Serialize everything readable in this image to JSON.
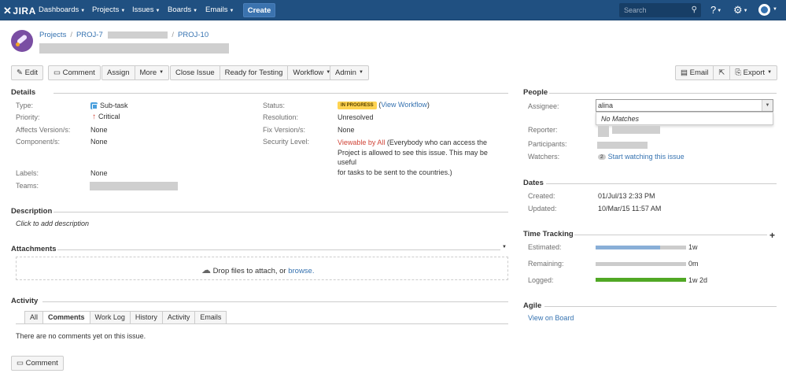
{
  "nav": {
    "logo": "JIRA",
    "items": [
      "Dashboards",
      "Projects",
      "Issues",
      "Boards",
      "Emails"
    ],
    "create": "Create",
    "search_placeholder": "Search"
  },
  "header": {
    "breadcrumb": [
      "Projects",
      "PROJ-7",
      "PROJ-10"
    ]
  },
  "toolbar": {
    "edit": "Edit",
    "comment": "Comment",
    "assign": "Assign",
    "more": "More",
    "close_issue": "Close Issue",
    "ready_for_testing": "Ready for Testing",
    "workflow": "Workflow",
    "admin": "Admin",
    "email": "Email",
    "export": "Export"
  },
  "details": {
    "heading": "Details",
    "type_label": "Type:",
    "type_value": "Sub-task",
    "priority_label": "Priority:",
    "priority_value": "Critical",
    "affects_label": "Affects Version/s:",
    "affects_value": "None",
    "components_label": "Component/s:",
    "components_value": "None",
    "labels_label": "Labels:",
    "labels_value": "None",
    "teams_label": "Teams:",
    "status_label": "Status:",
    "status_value": "IN PROGRESS",
    "view_workflow": "View Workflow",
    "resolution_label": "Resolution:",
    "resolution_value": "Unresolved",
    "fix_label": "Fix Version/s:",
    "fix_value": "None",
    "security_label": "Security Level:",
    "security_value": "Viewable by All",
    "security_desc_1": "(Everybody who can access the",
    "security_desc_2": "Project is allowed to see this issue. This may be useful",
    "security_desc_3": "for tasks to be sent to the countries.)"
  },
  "description": {
    "heading": "Description",
    "placeholder": "Click to add description"
  },
  "attachments": {
    "heading": "Attachments",
    "drop_text": "Drop files to attach, or",
    "browse": "browse."
  },
  "activity": {
    "heading": "Activity",
    "tabs": [
      "All",
      "Comments",
      "Work Log",
      "History",
      "Activity",
      "Emails"
    ],
    "active_tab": "Comments",
    "empty": "There are no comments yet on this issue.",
    "comment_button": "Comment"
  },
  "people": {
    "heading": "People",
    "assignee_label": "Assignee:",
    "assignee_value": "alina",
    "no_matches": "No Matches",
    "reporter_label": "Reporter:",
    "participants_label": "Participants:",
    "watchers_label": "Watchers:",
    "watch_count": "2",
    "watch_link": "Start watching this issue"
  },
  "dates": {
    "heading": "Dates",
    "created_label": "Created:",
    "created_value": "01/Jul/13 2:33 PM",
    "updated_label": "Updated:",
    "updated_value": "10/Mar/15 11:57 AM"
  },
  "time_tracking": {
    "heading": "Time Tracking",
    "estimated_label": "Estimated:",
    "estimated_value": "1w",
    "estimated_fraction": 0.71,
    "remaining_label": "Remaining:",
    "remaining_value": "0m",
    "remaining_fraction": 0,
    "logged_label": "Logged:",
    "logged_value": "1w 2d",
    "logged_fraction": 1,
    "colors": {
      "estimated": "#89afd7",
      "logged": "#51a825",
      "track": "#cccccc"
    }
  },
  "agile": {
    "heading": "Agile",
    "link": "View on Board"
  }
}
